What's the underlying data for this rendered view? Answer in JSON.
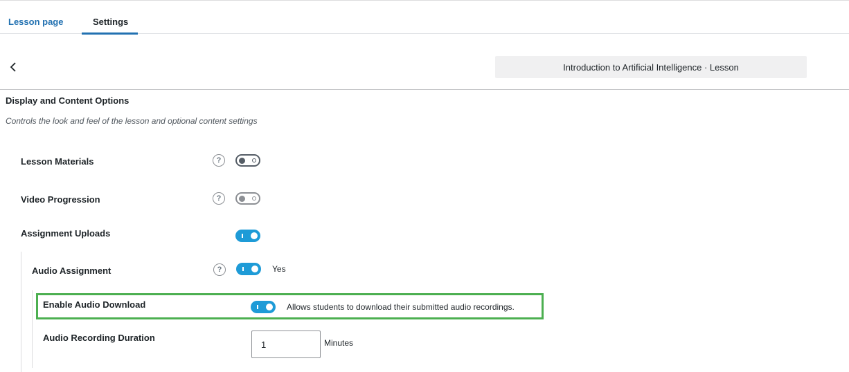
{
  "tabs": [
    {
      "label": "Lesson page",
      "active": false
    },
    {
      "label": "Settings",
      "active": true
    }
  ],
  "header": {
    "back_icon": "chevron-left-icon",
    "lesson_title": "Introduction to Artificial Intelligence · Lesson"
  },
  "section": {
    "title": "Display and Content Options",
    "description": "Controls the look and feel of the lesson and optional content settings"
  },
  "settings": {
    "lesson_materials": {
      "label": "Lesson Materials",
      "enabled": false
    },
    "video_progression": {
      "label": "Video Progression",
      "enabled": false
    },
    "assignment_uploads": {
      "label": "Assignment Uploads",
      "enabled": true
    },
    "audio_assignment": {
      "label": "Audio Assignment",
      "enabled": true,
      "value_text": "Yes"
    },
    "enable_audio_download": {
      "label": "Enable Audio Download",
      "enabled": true,
      "description": "Allows students to download their submitted audio recordings."
    },
    "audio_recording_duration": {
      "label": "Audio Recording Duration",
      "value": "1",
      "unit": "Minutes"
    }
  },
  "help_glyph": "?",
  "colors": {
    "accent": "#2271b1",
    "toggle_on": "#1e9bd7",
    "highlight": "#4caf50"
  }
}
